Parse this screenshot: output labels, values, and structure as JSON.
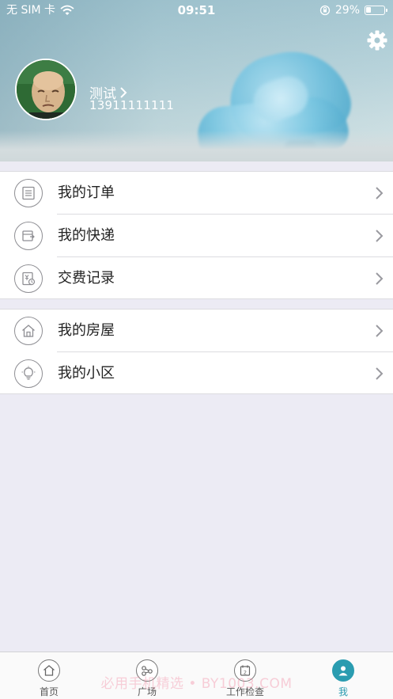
{
  "status_bar": {
    "carrier": "无 SIM 卡",
    "time": "09:51",
    "battery_text": "29%",
    "battery_level": 0.29,
    "icons": [
      "wifi-icon",
      "rotation-lock-icon",
      "battery-icon"
    ]
  },
  "header": {
    "settings_icon": "gear-icon",
    "avatar_caption": "头像",
    "user_name": "测试",
    "phone": "13911111111",
    "colors": {
      "text": "#ffffff",
      "banner_top": "#9fc3cf",
      "chair": "#6fc0de"
    }
  },
  "menu_groups": [
    {
      "items": [
        {
          "label": "我的订单",
          "icon": "order-list-icon"
        },
        {
          "label": "我的快递",
          "icon": "parcel-icon"
        },
        {
          "label": "交费记录",
          "icon": "payment-record-icon"
        }
      ]
    },
    {
      "items": [
        {
          "label": "我的房屋",
          "icon": "house-icon"
        },
        {
          "label": "我的小区",
          "icon": "lightbulb-icon"
        }
      ]
    }
  ],
  "tabbar": {
    "active_index": 3,
    "active_color": "#2a9cb0",
    "tabs": [
      {
        "label": "首页",
        "icon": "home-icon"
      },
      {
        "label": "广场",
        "icon": "share-icon"
      },
      {
        "label": "工作检查",
        "icon": "calendar-icon"
      },
      {
        "label": "我",
        "icon": "user-icon"
      }
    ]
  },
  "watermark": "必用手机精选 • BY1003.COM"
}
